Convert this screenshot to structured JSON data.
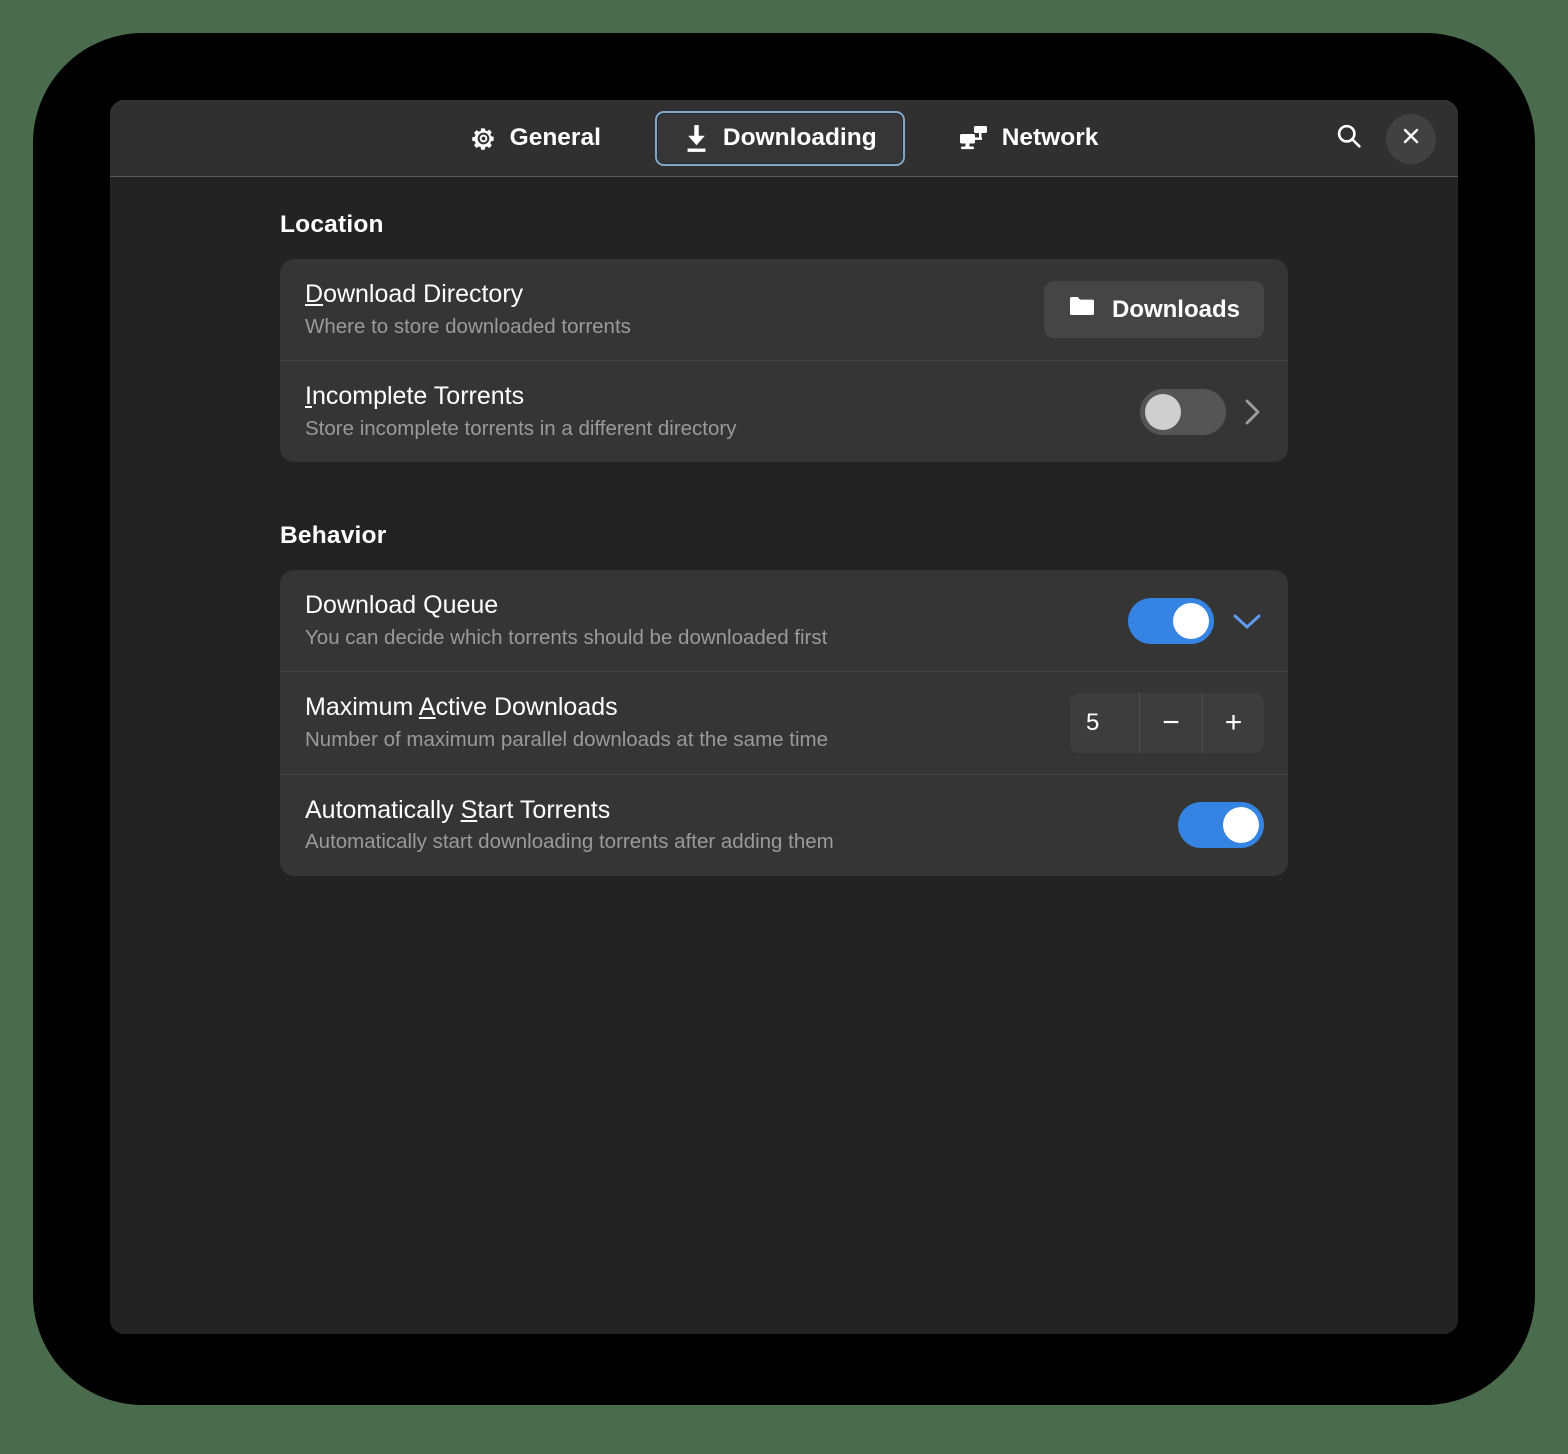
{
  "window": {
    "colors": {
      "desktop_background": "#4a6b4c",
      "headerbar": "#303030",
      "content_background": "#232323",
      "card": "#353535",
      "accent_blue": "#3584e4",
      "focus_border": "#7fa8cd",
      "title_text": "#ffffff",
      "subtitle_text": "#9a9a9a"
    }
  },
  "header": {
    "tabs": [
      {
        "id": "general",
        "label": "General",
        "icon": "gear-icon",
        "selected": false
      },
      {
        "id": "downloading",
        "label": "Downloading",
        "icon": "download-arrow-icon",
        "selected": true
      },
      {
        "id": "network",
        "label": "Network",
        "icon": "network-computers-icon",
        "selected": false
      }
    ],
    "actions": [
      {
        "id": "search",
        "icon": "search-icon",
        "label": ""
      },
      {
        "id": "close",
        "icon": "close-icon",
        "label": "×"
      }
    ]
  },
  "sections": [
    {
      "id": "location",
      "title": "Location",
      "rows": [
        {
          "id": "download-directory",
          "title_pre": "",
          "title_mnemonic": "D",
          "title_post": "ownload Directory",
          "subtitle": "Where to store downloaded torrents",
          "control": "folder-button",
          "button_label": "Downloads",
          "button_icon": "folder-icon"
        },
        {
          "id": "incomplete-torrents",
          "title_pre": "",
          "title_mnemonic": "I",
          "title_post": "ncomplete Torrents",
          "subtitle": "Store incomplete torrents in a different directory",
          "control": "switch-with-chevron",
          "switch_state": "off",
          "chevron": "chevron-right-icon"
        }
      ]
    },
    {
      "id": "behavior",
      "title": "Behavior",
      "rows": [
        {
          "id": "download-queue",
          "title_pre": "Download Queue",
          "title_mnemonic": "",
          "title_post": "",
          "subtitle": "You can decide which torrents should be downloaded first",
          "control": "switch-with-chevron",
          "switch_state": "on",
          "chevron": "chevron-down-icon"
        },
        {
          "id": "maximum-active-downloads",
          "title_pre": "Maximum ",
          "title_mnemonic": "A",
          "title_post": "ctive Downloads",
          "subtitle": "Number of maximum parallel downloads at the same time",
          "control": "spin-button",
          "value": "5",
          "decrement_label": "−",
          "increment_label": "+"
        },
        {
          "id": "automatically-start-torrents",
          "title_pre": "Automatically ",
          "title_mnemonic": "S",
          "title_post": "tart Torrents",
          "subtitle": "Automatically start downloading torrents after adding them",
          "control": "switch",
          "switch_state": "on"
        }
      ]
    }
  ]
}
